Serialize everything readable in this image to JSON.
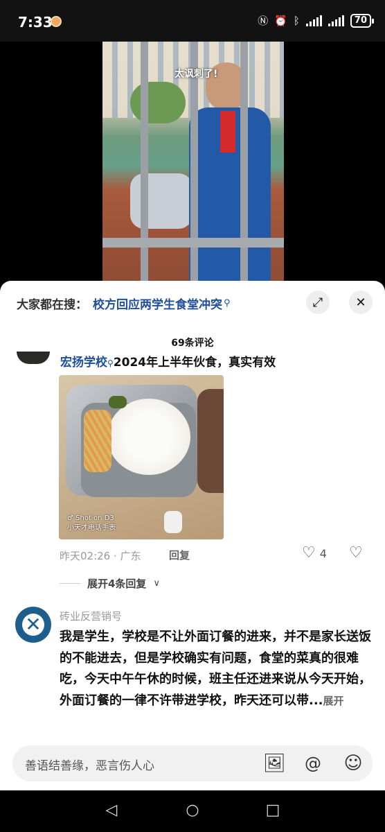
{
  "status_bar": {
    "time": "7:33",
    "battery": "70"
  },
  "video": {
    "caption": "太讽刺了!"
  },
  "header": {
    "hot_search_label": "大家都在搜：",
    "hot_search_query": "校方回应两学生食堂冲突",
    "comment_count": "69条评论"
  },
  "comments": [
    {
      "link_text": "宏扬学校",
      "text": "2024年上半年伙食，真实有效",
      "photo_watermark_line1": "Shot on D3",
      "photo_watermark_line2": "小天才电话手表",
      "time_location": "昨天02:26 · 广东",
      "reply_label": "回复",
      "likes": "4",
      "expand_label": "展开4条回复"
    },
    {
      "username": "砖业反营销号",
      "text": "我是学生，学校是不让外面订餐的进来，并不是家长送饭的不能进去，但是学校确实有问题，食堂的菜真的很难吃，今天中午午休的时候，班主任还进来说从今天开始，外面订餐的一律不许带进学校，昨天还可以带...",
      "more_label": "展开"
    }
  ],
  "input": {
    "placeholder": "善语结善缘，恶言伤人心"
  },
  "icons": {
    "hot_search": "search-icon",
    "expand": "expand-icon",
    "close": "close-icon",
    "like": "heart-icon",
    "dislike": "broken-heart-icon",
    "image": "image-icon",
    "mention": "at-icon",
    "emoji": "emoji-icon"
  },
  "colors": {
    "link": "#1e4f9c",
    "sheet_background": "#ffffff",
    "input_background": "#f1f1f1"
  }
}
